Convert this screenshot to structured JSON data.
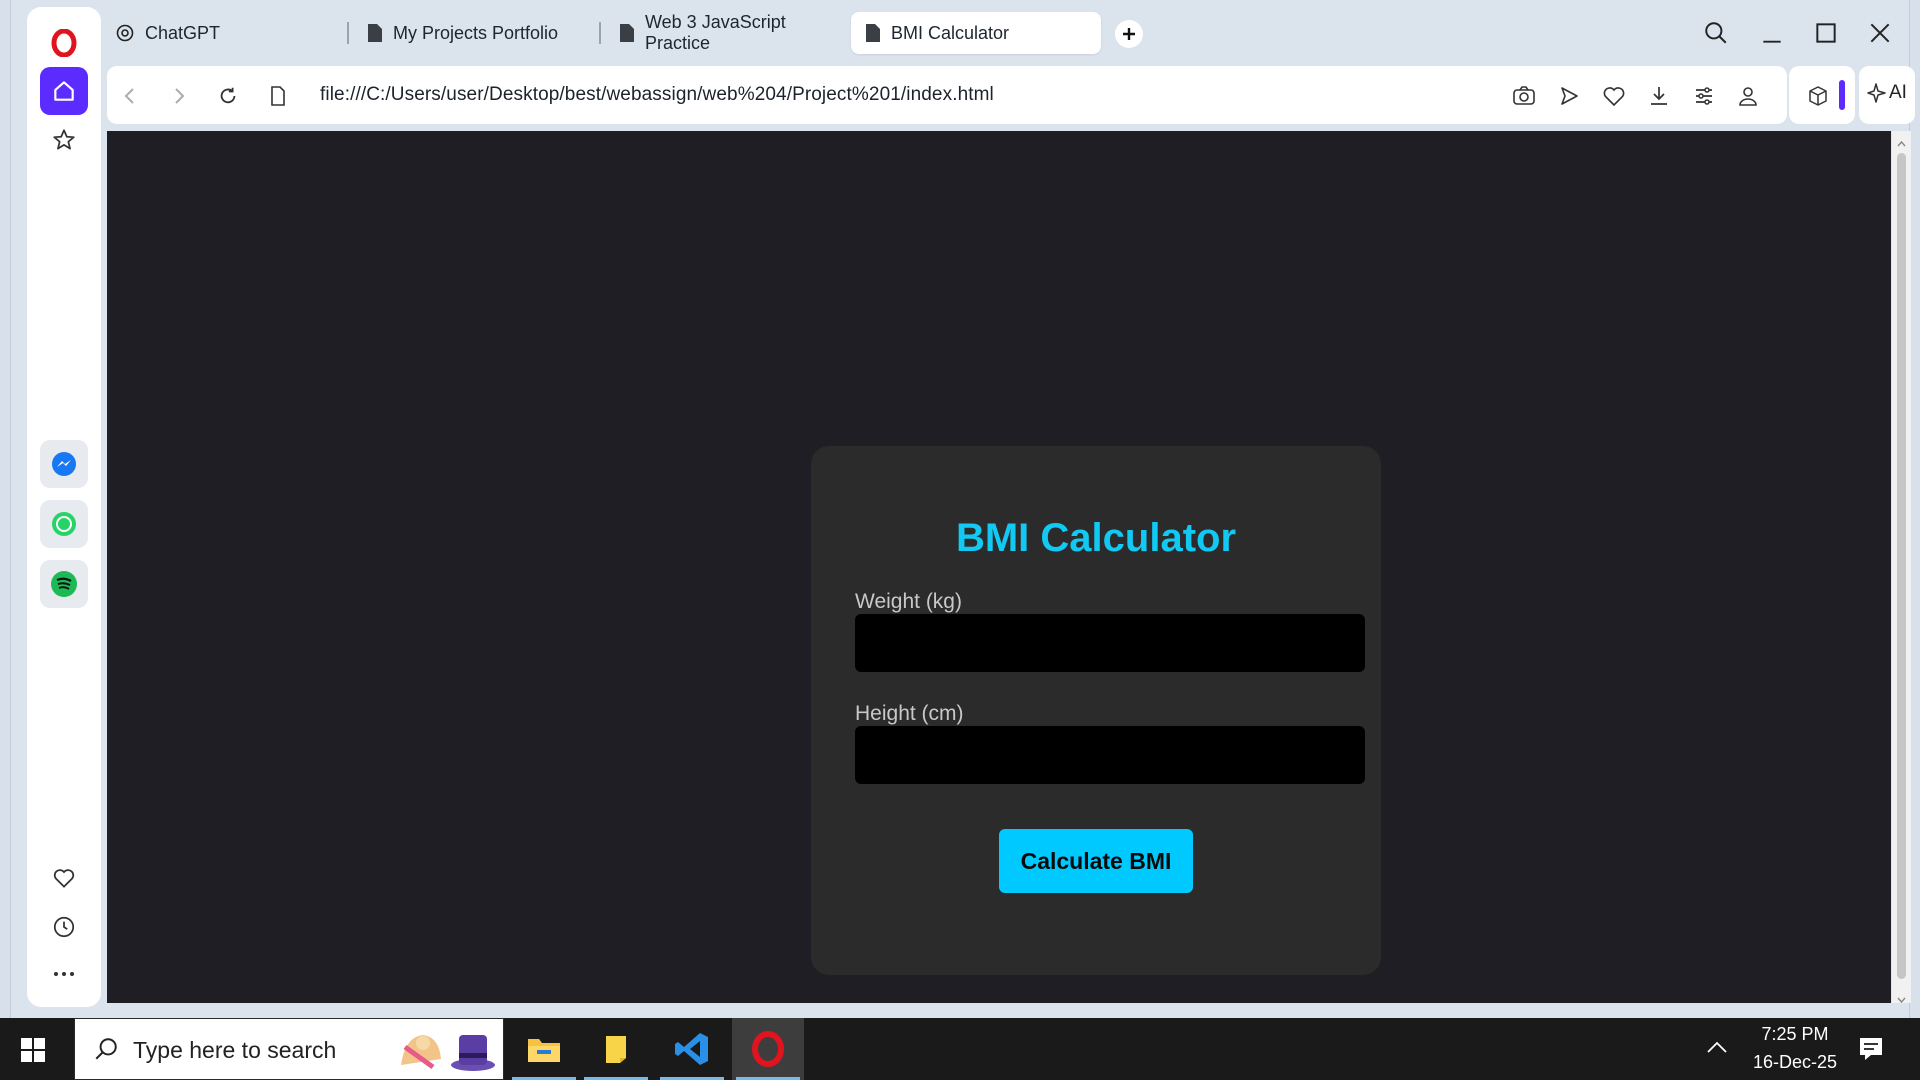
{
  "tabs": [
    {
      "label": "ChatGPT",
      "icon": "chatgpt-icon"
    },
    {
      "label": "My Projects Portfolio",
      "icon": "document-icon"
    },
    {
      "label": "Web 3 JavaScript Practice",
      "icon": "document-icon"
    },
    {
      "label": "BMI Calculator",
      "icon": "document-icon",
      "active": true
    }
  ],
  "address": {
    "url": "file:///C:/Users/user/Desktop/best/webassign/web%204/Project%201/index.html"
  },
  "ai_button_label": "AI",
  "page": {
    "title": "BMI Calculator",
    "weight_label": "Weight (kg)",
    "height_label": "Height (cm)",
    "weight_value": "",
    "height_value": "",
    "button_label": "Calculate BMI"
  },
  "taskbar": {
    "search_placeholder": "Type here to search",
    "time": "7:25 PM",
    "date": "16-Dec-25",
    "apps": [
      "file-explorer-icon",
      "sticky-notes-icon",
      "vscode-icon",
      "opera-icon"
    ]
  },
  "colors": {
    "accent": "#11c9f2",
    "button": "#00c9ff",
    "card": "#2b2b2b",
    "page_bg": "#1e1e24",
    "opera_red": "#e0141e",
    "sidebar_active": "#5b2bff"
  }
}
